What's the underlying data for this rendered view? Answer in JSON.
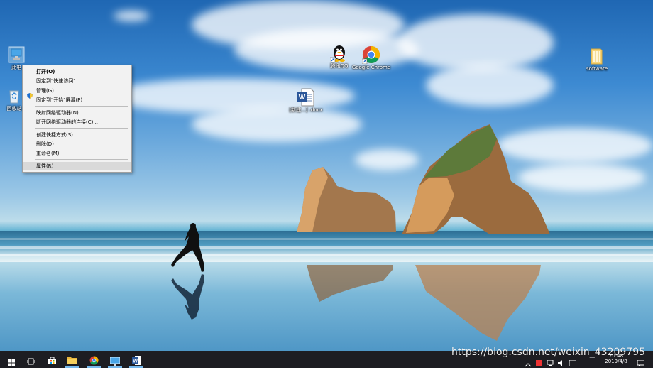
{
  "desktop": {
    "icons": [
      {
        "label": "此电",
        "name": "this-pc"
      },
      {
        "label": "回收站",
        "name": "recycle-bin"
      },
      {
        "label": "腾讯QQ",
        "name": "qq"
      },
      {
        "label": "Google Chrome",
        "name": "chrome"
      },
      {
        "label": "software",
        "name": "software-folder"
      },
      {
        "label": "[新建...] .docx",
        "name": "word-doc"
      }
    ]
  },
  "context_menu": {
    "items": [
      {
        "label": "打开(O)",
        "bold": true
      },
      {
        "label": "固定到\"快速访问\""
      },
      {
        "label": "管理(G)",
        "icon": "shield-icon"
      },
      {
        "label": "固定到\"开始\"屏幕(P)"
      },
      {
        "label": "映射网络驱动器(N)..."
      },
      {
        "label": "断开网络驱动器的连接(C)..."
      },
      {
        "label": "创建快捷方式(S)"
      },
      {
        "label": "删除(D)"
      },
      {
        "label": "重命名(M)"
      },
      {
        "label": "属性(R)",
        "highlighted": true
      }
    ]
  },
  "taskbar": {
    "buttons": [
      {
        "name": "start-button",
        "icon": "windows-logo-icon"
      },
      {
        "name": "task-view-button",
        "icon": "task-view-icon"
      },
      {
        "name": "store-button",
        "icon": "store-bag-icon"
      },
      {
        "name": "file-explorer-button",
        "icon": "folder-icon"
      },
      {
        "name": "chrome-taskbar-button",
        "icon": "chrome-icon"
      },
      {
        "name": "control-panel-button",
        "icon": "monitor-icon"
      },
      {
        "name": "word-taskbar-button",
        "icon": "word-icon"
      }
    ],
    "clock": {
      "time": "20:48",
      "date": "2019/4/8"
    }
  },
  "watermark": "https://blog.csdn.net/weixin_43209795"
}
